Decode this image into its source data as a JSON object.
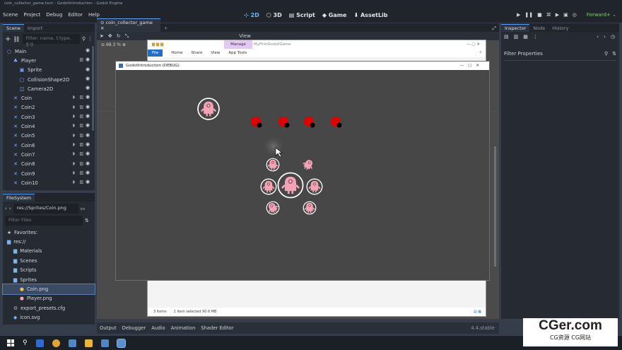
{
  "window": {
    "title": "coin_collector_game.tscn - GodotIntroduction - Godot Engine"
  },
  "menu": {
    "items": [
      "Scene",
      "Project",
      "Debug",
      "Editor",
      "Help"
    ]
  },
  "workspace": {
    "tabs": [
      "2D",
      "3D",
      "Script",
      "Game",
      "AssetLib"
    ],
    "active": "2D"
  },
  "renderer": "Forward+",
  "scene_dock": {
    "tabs": [
      "Scene",
      "Import"
    ],
    "filter_placeholder": "Filter: name, t:type, g:g",
    "nodes": [
      {
        "label": "Main",
        "depth": 0,
        "icon": "node2d-icon"
      },
      {
        "label": "Player",
        "depth": 1,
        "icon": "player-icon"
      },
      {
        "label": "Sprite",
        "depth": 2,
        "icon": "sprite-icon"
      },
      {
        "label": "CollisionShape2D",
        "depth": 2,
        "icon": "collision-icon"
      },
      {
        "label": "Camera2D",
        "depth": 2,
        "icon": "camera-icon"
      },
      {
        "label": "Coin",
        "depth": 1,
        "icon": "coin-icon"
      },
      {
        "label": "Coin2",
        "depth": 1,
        "icon": "coin-icon"
      },
      {
        "label": "Coin3",
        "depth": 1,
        "icon": "coin-icon"
      },
      {
        "label": "Coin4",
        "depth": 1,
        "icon": "coin-icon"
      },
      {
        "label": "Coin5",
        "depth": 1,
        "icon": "coin-icon"
      },
      {
        "label": "Coin6",
        "depth": 1,
        "icon": "coin-icon"
      },
      {
        "label": "Coin7",
        "depth": 1,
        "icon": "coin-icon"
      },
      {
        "label": "Coin8",
        "depth": 1,
        "icon": "coin-icon"
      },
      {
        "label": "Coin9",
        "depth": 1,
        "icon": "coin-icon"
      },
      {
        "label": "Coin10",
        "depth": 1,
        "icon": "coin-icon"
      }
    ]
  },
  "filesystem": {
    "tab": "FileSystem",
    "path": "res://Sprites/Coin.png",
    "filter_placeholder": "Filter Files",
    "items": [
      {
        "label": "Favorites:",
        "depth": 0,
        "kind": "star"
      },
      {
        "label": "res://",
        "depth": 0,
        "kind": "folder"
      },
      {
        "label": "Materials",
        "depth": 1,
        "kind": "folder"
      },
      {
        "label": "Scenes",
        "depth": 1,
        "kind": "folder"
      },
      {
        "label": "Scripts",
        "depth": 1,
        "kind": "folder"
      },
      {
        "label": "Sprites",
        "depth": 1,
        "kind": "folder"
      },
      {
        "label": "Coin.png",
        "depth": 2,
        "kind": "image",
        "selected": true
      },
      {
        "label": "Player.png",
        "depth": 2,
        "kind": "image"
      },
      {
        "label": "export_presets.cfg",
        "depth": 1,
        "kind": "file"
      },
      {
        "label": "icon.svg",
        "depth": 1,
        "kind": "svg"
      }
    ]
  },
  "editor_tab": "coin_collector_game",
  "zoom_label": "68.3 %",
  "view_label": "View",
  "explorer": {
    "title": "MyFirstGodotGame",
    "manage": "Manage",
    "ribbon": [
      "File",
      "Home",
      "Share",
      "View",
      "App Tools"
    ],
    "status_items": "3 items",
    "status_selected": "1 item selected  90.6 MB"
  },
  "debug_window": {
    "title": "GodotIntroduction (DEBUG)"
  },
  "inspector": {
    "tabs": [
      "Inspector",
      "Node",
      "History"
    ],
    "filter_label": "Filter Properties"
  },
  "bottom_panel": {
    "tabs": [
      "Output",
      "Debugger",
      "Audio",
      "Animation",
      "Shader Editor"
    ],
    "version": "4.4.stable"
  },
  "watermark": {
    "big": "CGer.com",
    "small": "CG资源 CG网站"
  },
  "colors": {
    "accent": "#66b6ff",
    "renderer": "#7ed26a",
    "enemy_red": "#e00000",
    "player_pink": "#f0a0b4"
  }
}
